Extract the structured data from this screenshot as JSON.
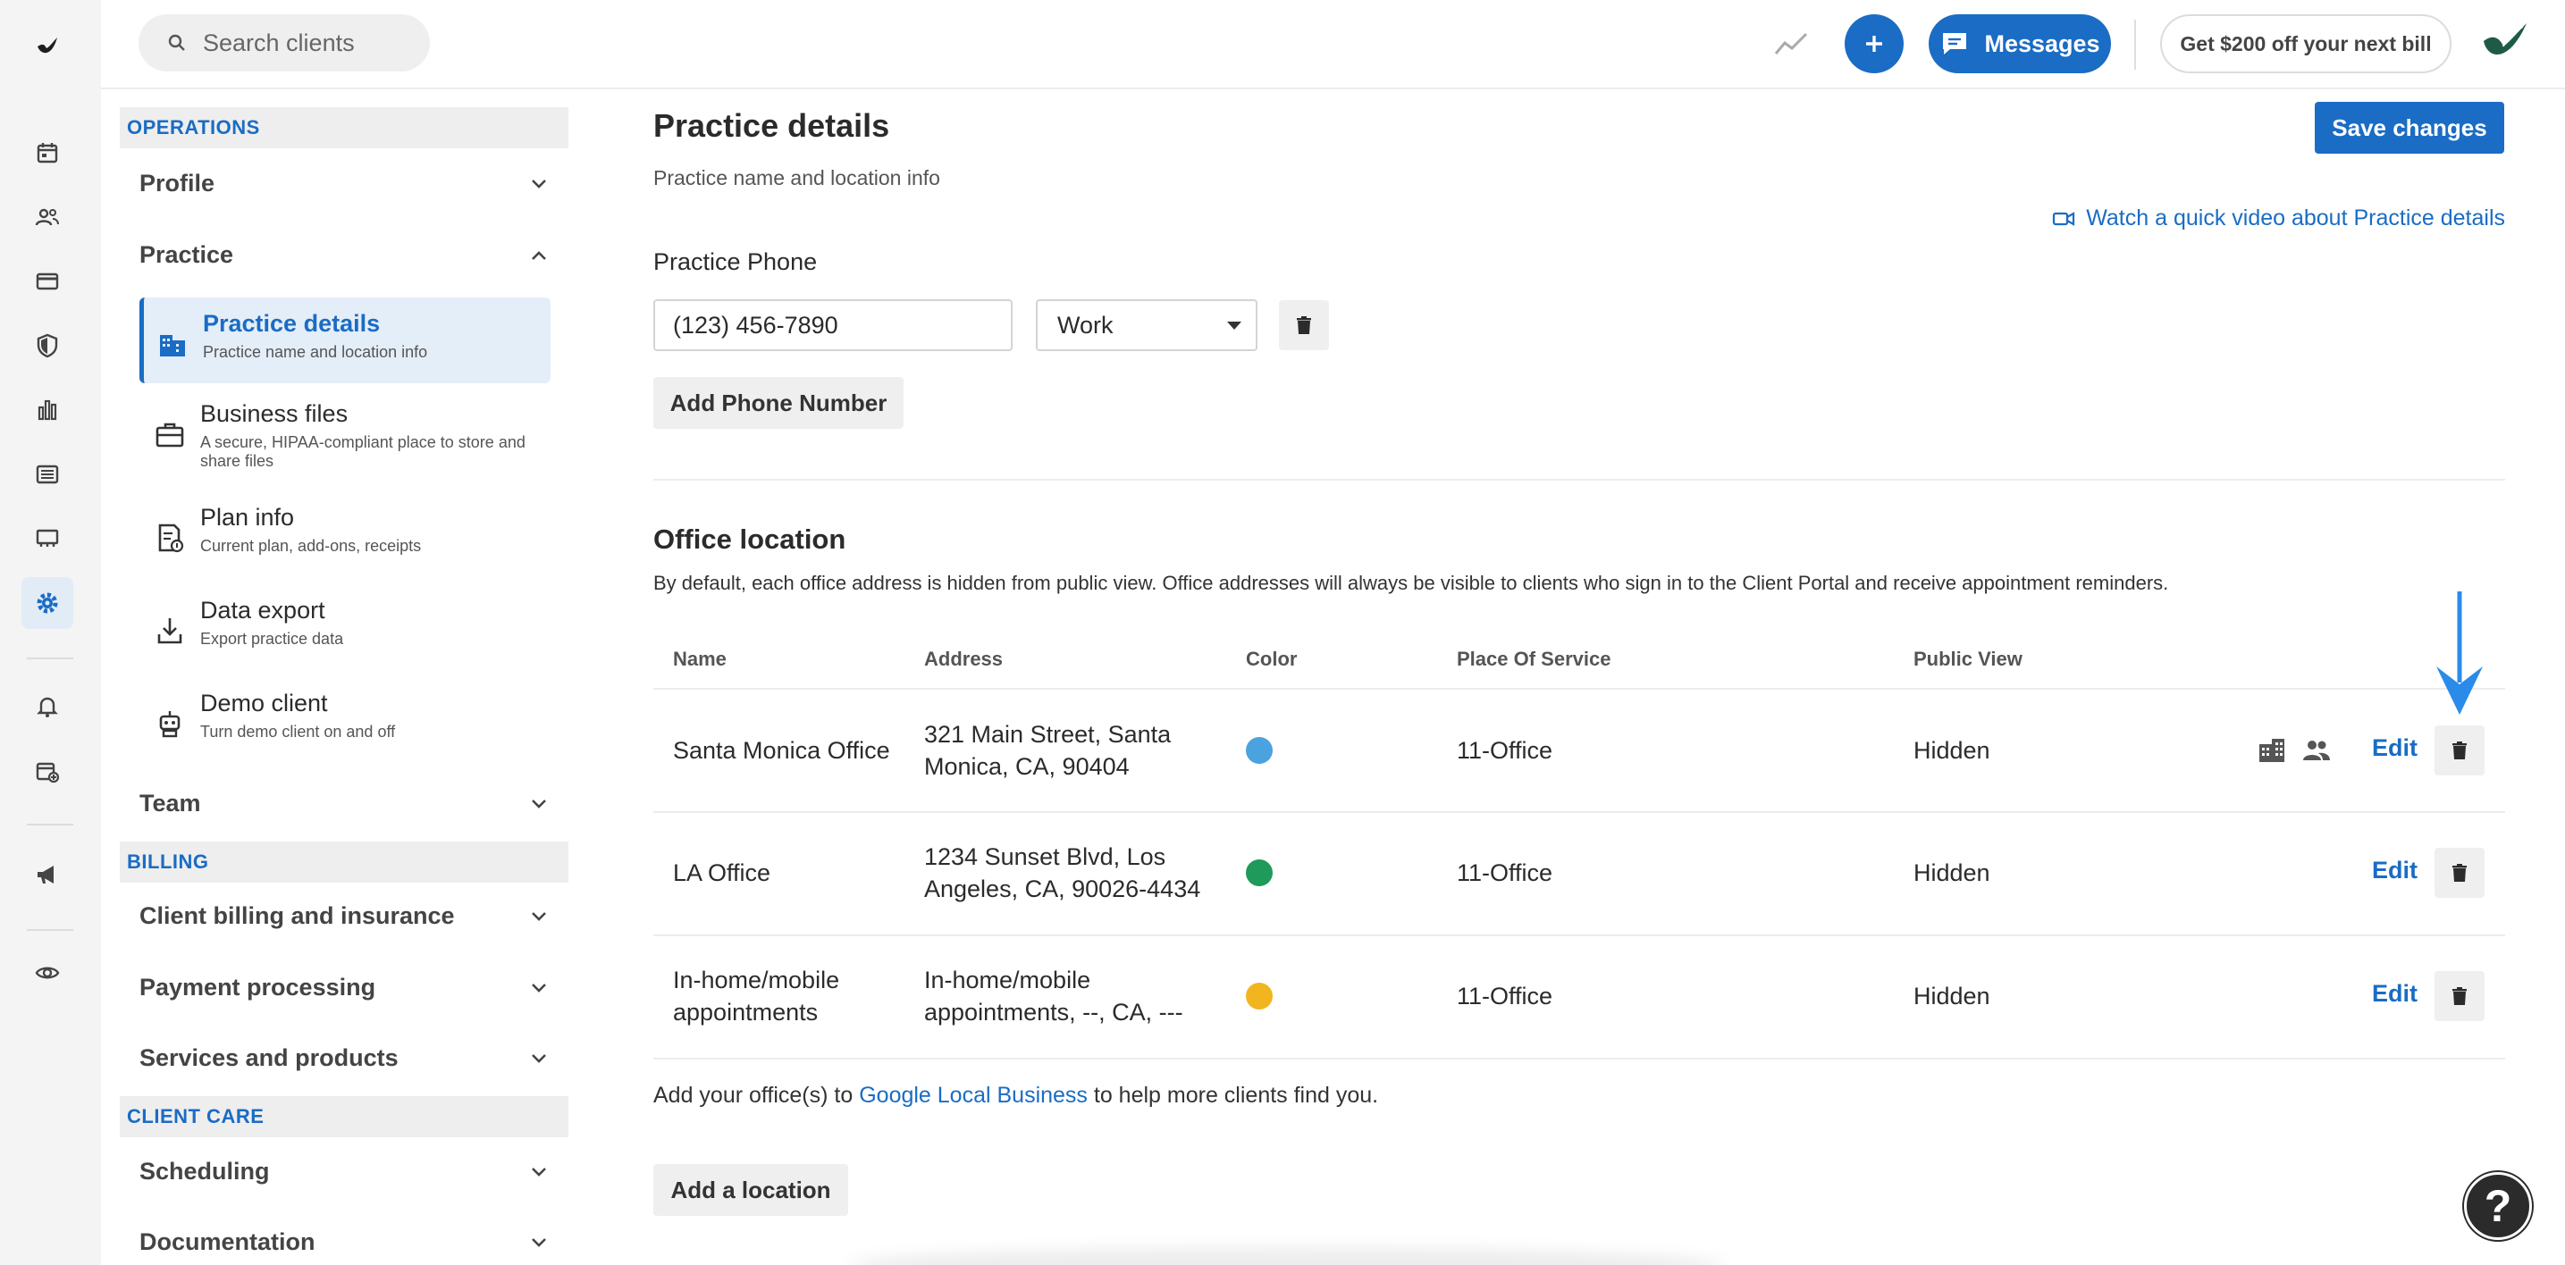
{
  "colors": {
    "accent": "#1a6cc4",
    "dot_blue": "#4aa3df",
    "dot_green": "#1f9a5a",
    "dot_yellow": "#f2b51f"
  },
  "rail": {
    "items": [
      "logo-icon",
      "calendar-icon",
      "clients-icon",
      "billing-icon",
      "insurance-icon",
      "analytics-icon",
      "reports-icon",
      "marketplace-icon",
      "settings-icon",
      "notifications-icon",
      "requests-icon",
      "marketing-icon",
      "preview-icon"
    ]
  },
  "topbar": {
    "search_placeholder": "Search clients",
    "messages_label": "Messages",
    "promo_label": "Get $200 off your next bill"
  },
  "nav": {
    "operations_label": "OPERATIONS",
    "profile_label": "Profile",
    "practice_label": "Practice",
    "sub_items": [
      {
        "title": "Practice details",
        "desc": "Practice name and location info"
      },
      {
        "title": "Business files",
        "desc": "A secure, HIPAA-compliant place to store and share files"
      },
      {
        "title": "Plan info",
        "desc": "Current plan, add-ons, receipts"
      },
      {
        "title": "Data export",
        "desc": "Export practice data"
      },
      {
        "title": "Demo client",
        "desc": "Turn demo client on and off"
      }
    ],
    "team_label": "Team",
    "billing_label": "BILLING",
    "billing_items": [
      "Client billing and insurance",
      "Payment processing",
      "Services and products"
    ],
    "client_care_label": "CLIENT CARE",
    "client_care_items": [
      "Scheduling",
      "Documentation"
    ]
  },
  "main": {
    "title": "Practice details",
    "subtitle": "Practice name and location info",
    "save_label": "Save changes",
    "video_link": "Watch a quick video about Practice details",
    "phone_label": "Practice Phone",
    "phone_value": "(123) 456-7890",
    "phone_type": "Work",
    "add_phone_label": "Add Phone Number",
    "office_title": "Office location",
    "office_desc": "By default, each office address is hidden from public view. Office addresses will always be visible to clients who sign in to the Client Portal and receive appointment reminders.",
    "columns": [
      "Name",
      "Address",
      "Color",
      "Place Of Service",
      "Public View"
    ],
    "rows": [
      {
        "name_1": "Santa Monica Office",
        "name_2": "",
        "addr_1": "321 Main Street, Santa",
        "addr_2": "Monica, CA, 90404",
        "pos": "11-Office",
        "view": "Hidden",
        "edit": "Edit"
      },
      {
        "name_1": "LA Office",
        "name_2": "",
        "addr_1": "1234 Sunset Blvd, Los",
        "addr_2": "Angeles, CA, 90026-4434",
        "pos": "11-Office",
        "view": "Hidden",
        "edit": "Edit"
      },
      {
        "name_1": "In-home/mobile",
        "name_2": "appointments",
        "addr_1": "In-home/mobile",
        "addr_2": "appointments, --, CA, ---",
        "pos": "11-Office",
        "view": "Hidden",
        "edit": "Edit"
      }
    ],
    "footer_pre": "Add your office(s) to",
    "footer_link": "Google Local Business",
    "footer_post": "to help more clients find you.",
    "add_location_label": "Add a location",
    "help_label": "?"
  }
}
